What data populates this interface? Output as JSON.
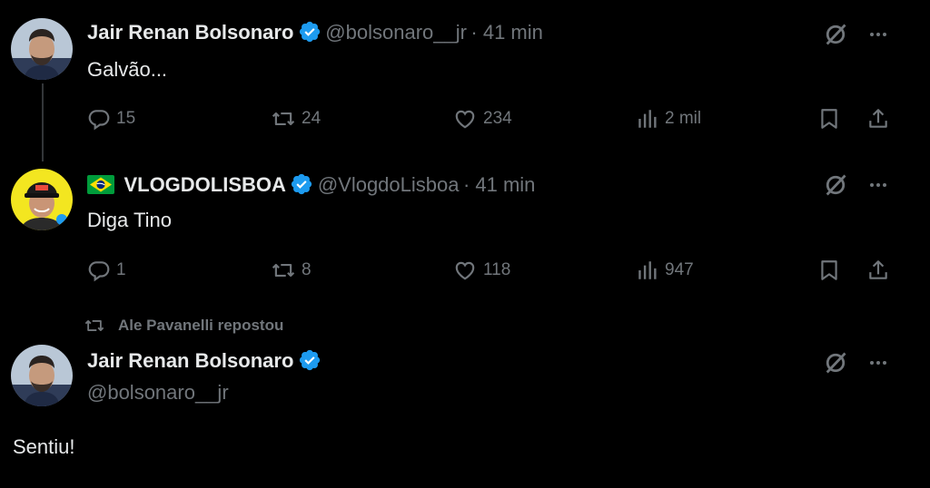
{
  "colors": {
    "background": "#000000",
    "text": "#e7e9ea",
    "muted": "#71767b",
    "verified": "#1d9bf0",
    "divider": "#333639"
  },
  "tweets": [
    {
      "name": "Jair Renan Bolsonaro",
      "handle": "@bolsonaro__jr",
      "time": "· 41 min",
      "text": "Galvão...",
      "replies": "15",
      "reposts": "24",
      "likes": "234",
      "views": "2 mil"
    },
    {
      "flag": "brazil-flag-icon",
      "name": "VLOGDOLISBOA",
      "handle": "@VlogdoLisboa",
      "time": "· 41 min",
      "text": "Diga Tino",
      "replies": "1",
      "reposts": "8",
      "likes": "118",
      "views": "947"
    },
    {
      "repost_note": "Ale Pavanelli repostou",
      "name": "Jair Renan Bolsonaro",
      "handle": "@bolsonaro__jr",
      "text": "Sentiu!"
    }
  ],
  "icons": {
    "grok": "grok-icon",
    "more": "more-icon",
    "reply": "reply-icon",
    "repost": "repost-icon",
    "like": "like-icon",
    "views": "views-icon",
    "bookmark": "bookmark-icon",
    "share": "share-icon"
  }
}
